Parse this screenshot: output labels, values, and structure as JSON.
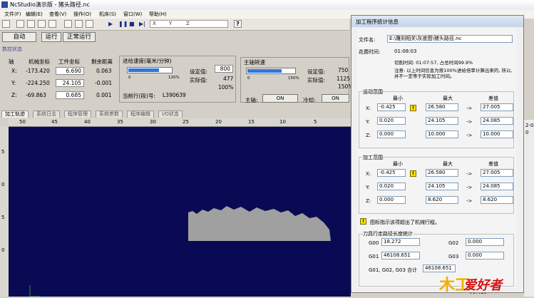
{
  "window": {
    "title": "NcStudio演示版 - 猪头路径.nc"
  },
  "menu": [
    "文件(F)",
    "编辑(E)",
    "查看(V)",
    "操作(O)",
    "机床(S)",
    "窗口(W)",
    "帮助(H)"
  ],
  "xyz_field": {
    "x": "X",
    "y": "Y",
    "z": "Z"
  },
  "help_glyph": "?",
  "mode": {
    "auto": "自动",
    "run": "运行",
    "normal_run": "正常运行"
  },
  "status_label": "数控状态",
  "coords": {
    "headers": {
      "axis": "轴",
      "machine": "机械坐标",
      "work": "工件坐标",
      "remaining": "剩余距离"
    },
    "rows": [
      {
        "axis": "X:",
        "machine": "-173.420",
        "work": "6.690",
        "remaining": "0.063"
      },
      {
        "axis": "Y:",
        "machine": "-224.250",
        "work": "24.105",
        "remaining": "-0.001"
      },
      {
        "axis": "Z:",
        "machine": "-69.863",
        "work": "0.685",
        "remaining": "0.001"
      }
    ]
  },
  "feed": {
    "title": "进给速度(毫米/分钟)",
    "scale_min": "0",
    "scale_max": "120%",
    "fill_fraction": 0.72,
    "set_label": "设定值:",
    "set_value": "800",
    "actual_label": "实际值:",
    "actual_value": "477",
    "percent": "100%",
    "line_label": "当前行(段)号:",
    "line_value": "L390639"
  },
  "spindle": {
    "title": "主轴转速",
    "scale_min": "0",
    "scale_max": "150%",
    "fill_fraction": 0.72,
    "set_label": "设定值:",
    "set_value": "750",
    "actual_label": "实际值:",
    "actual_value": "1125",
    "percent": "150%",
    "spindle_label": "主轴:",
    "spindle_btn": "ON",
    "coolant_label": "冷却:",
    "coolant_btn": "ON"
  },
  "tabs": [
    "加工轨迹",
    "系统日志",
    "程序管理",
    "系统参数",
    "程序编辑",
    "I/O状态"
  ],
  "ruler": {
    "top_ticks": [
      "50",
      "45",
      "40",
      "35",
      "30",
      "25",
      "20",
      "15",
      "10",
      "5"
    ],
    "left_ticks": [
      "5",
      "0",
      "5",
      "0"
    ]
  },
  "dialog": {
    "title": "加工程序统计信息",
    "file_label": "文件名:",
    "file_value": "E:\\雕刻相关\\灰度图\\猪头路径.nc",
    "time_label": "花费时间:",
    "time_value": "01:08:03",
    "cut_time": "切削时间: 01:07:57, 占总时间99.9%",
    "note": "注意: 以上时间信息为按100%进给倍率计算出来的, 所以, 并不一定等于实际加工时间。",
    "motion": {
      "title": "运动范围",
      "headers": {
        "min": "最小",
        "max": "最大",
        "diff": "差值"
      },
      "rows": [
        {
          "axis": "X:",
          "min": "-0.425",
          "max": "26.580",
          "arrow": "->",
          "diff": "27.005",
          "warn": true
        },
        {
          "axis": "Y:",
          "min": "0.020",
          "max": "24.105",
          "arrow": "->",
          "diff": "24.085",
          "warn": false
        },
        {
          "axis": "Z:",
          "min": "0.000",
          "max": "10.000",
          "arrow": "->",
          "diff": "10.000",
          "warn": false
        }
      ]
    },
    "process": {
      "title": "加工范围",
      "headers": {
        "min": "最小",
        "max": "最大",
        "diff": "差值"
      },
      "rows": [
        {
          "axis": "X:",
          "min": "-0.425",
          "max": "26.580",
          "arrow": "->",
          "diff": "27.005",
          "warn": true
        },
        {
          "axis": "Y:",
          "min": "0.020",
          "max": "24.105",
          "arrow": "->",
          "diff": "24.085",
          "warn": false
        },
        {
          "axis": "Z:",
          "min": "0.000",
          "max": "8.620",
          "arrow": "->",
          "diff": "8.620",
          "warn": false
        }
      ]
    },
    "warning_text": "图标指示该项超出了机械行程。",
    "path": {
      "title": "刀具行走路径长度统计",
      "g00_label": "G00",
      "g00": "18.272",
      "g02_label": "G02",
      "g02": "0.000",
      "g01_label": "G01",
      "g01": "46108.651",
      "g03_label": "G03",
      "g03": "0.000",
      "total_label": "G01, G02, G03 合计",
      "total": "46108.651"
    }
  },
  "edge": {
    "line1": "2-0",
    "line2": "0",
    "bottom": "V0.410"
  },
  "logo_text": "爱好者",
  "logo_mark": "木工",
  "warn_glyph": "!",
  "colors": {
    "canvas": "#0a0a54",
    "surface": "#a0a0a0",
    "progress": "#2f76d8",
    "warn": "#f5e000"
  }
}
